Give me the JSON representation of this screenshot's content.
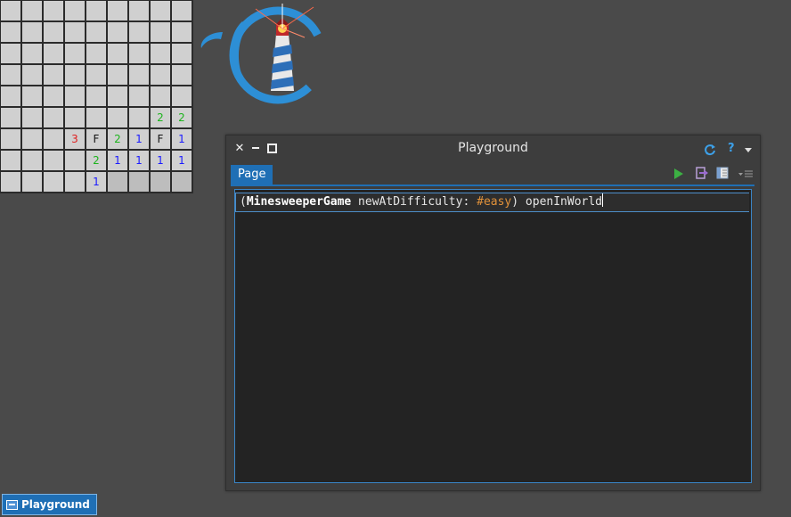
{
  "minesweeper": {
    "rows": [
      [
        "",
        "",
        "",
        "",
        "",
        "",
        "",
        "",
        ""
      ],
      [
        "",
        "",
        "",
        "",
        "",
        "",
        "",
        "",
        ""
      ],
      [
        "",
        "",
        "",
        "",
        "",
        "",
        "",
        "",
        ""
      ],
      [
        "",
        "",
        "",
        "",
        "",
        "",
        "",
        "",
        ""
      ],
      [
        "",
        "",
        "",
        "",
        "",
        "",
        "",
        "",
        ""
      ],
      [
        "",
        "",
        "",
        "",
        "",
        "",
        "",
        "2",
        "2"
      ],
      [
        "",
        "",
        "",
        "3",
        "F",
        "2",
        "1",
        "F",
        "1"
      ],
      [
        "",
        "",
        "",
        "",
        "2",
        "1",
        "1",
        "1",
        "1"
      ],
      [
        "",
        "",
        "",
        "",
        "1",
        "",
        "",
        "",
        ""
      ]
    ],
    "colors": {
      "1": "#1a1aff",
      "2": "#1db41d",
      "3": "#e02020",
      "F": "#111111"
    }
  },
  "window": {
    "title": "Playground",
    "tab_label": "Page",
    "editor": {
      "open_paren": "(",
      "class_name": "MinesweeperGame",
      "selector": " newAtDifficulty: ",
      "symbol": "#easy",
      "close_part": ") openInWorld"
    },
    "help_label": "?"
  },
  "taskbar": {
    "item_label": "Playground"
  },
  "icons": {
    "close": "close-icon",
    "minimize": "minimize-icon",
    "maximize": "maximize-icon",
    "refresh": "refresh-icon",
    "help": "help-icon",
    "menu": "chevron-down-icon",
    "run": "play-icon",
    "do_it": "do-it-icon",
    "inspect": "inspect-icon",
    "pane_menu": "list-menu-icon"
  },
  "theme": {
    "accent": "#1f6fb5",
    "background": "#4a4a4a",
    "editor_bg": "#232323"
  }
}
